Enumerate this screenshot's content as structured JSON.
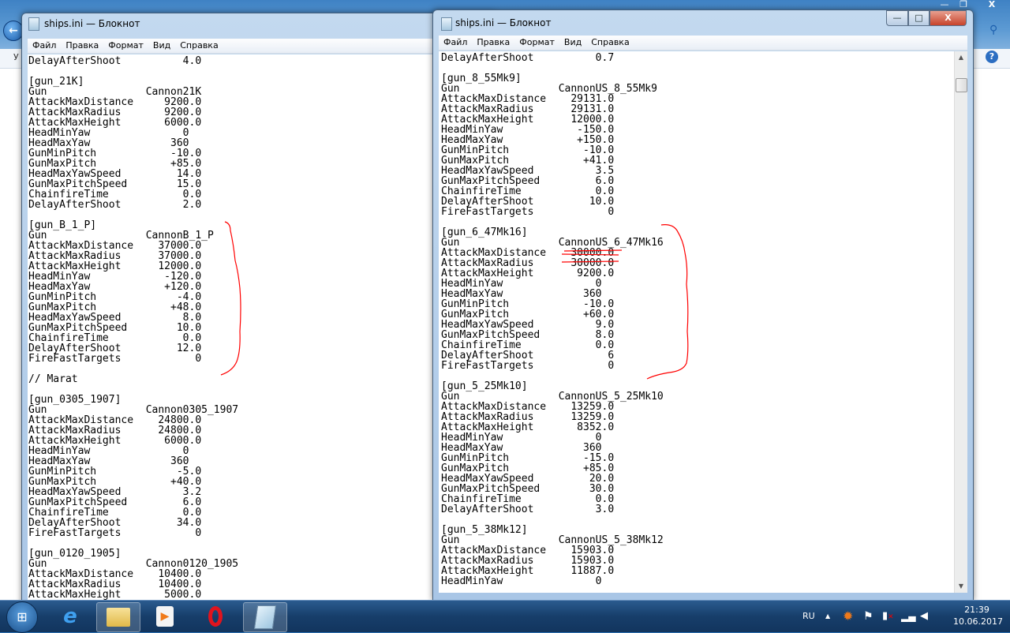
{
  "colors": {
    "annotation": "#ff0000",
    "taskbar": "#173e6a",
    "title_bar": "#b9d1ea"
  },
  "background_window": {
    "nav_letter": "У",
    "icons": [
      "back-arrow-icon",
      "search-icon",
      "help-icon"
    ],
    "help_glyph": "?"
  },
  "left_window": {
    "title": "ships.ini — Блокнот",
    "menu": [
      "Файл",
      "Правка",
      "Формат",
      "Вид",
      "Справка"
    ],
    "lines": [
      "DelayAfterShoot          4.0",
      "",
      "[gun_21K]",
      "Gun                Cannon21K",
      "AttackMaxDistance     9200.0",
      "AttackMaxRadius       9200.0",
      "AttackMaxHeight       6000.0",
      "HeadMinYaw               0",
      "HeadMaxYaw             360",
      "GunMinPitch            -10.0",
      "GunMaxPitch            +85.0",
      "HeadMaxYawSpeed         14.0",
      "GunMaxPitchSpeed        15.0",
      "ChainfireTime            0.0",
      "DelayAfterShoot          2.0",
      "",
      "[gun_B_1_P]",
      "Gun                CannonB_1_P",
      "AttackMaxDistance    37000.0",
      "AttackMaxRadius      37000.0",
      "AttackMaxHeight      12000.0",
      "HeadMinYaw            -120.0",
      "HeadMaxYaw            +120.0",
      "GunMinPitch             -4.0",
      "GunMaxPitch            +48.0",
      "HeadMaxYawSpeed          8.0",
      "GunMaxPitchSpeed        10.0",
      "ChainfireTime            0.0",
      "DelayAfterShoot         12.0",
      "FireFastTargets            0",
      "",
      "// Marat",
      "",
      "[gun_0305_1907]",
      "Gun                Cannon0305_1907",
      "AttackMaxDistance    24800.0",
      "AttackMaxRadius      24800.0",
      "AttackMaxHeight       6000.0",
      "HeadMinYaw               0",
      "HeadMaxYaw             360",
      "GunMinPitch             -5.0",
      "GunMaxPitch            +40.0",
      "HeadMaxYawSpeed          3.2",
      "GunMaxPitchSpeed         6.0",
      "ChainfireTime            0.0",
      "DelayAfterShoot         34.0",
      "FireFastTargets            0",
      "",
      "[gun_0120_1905]",
      "Gun                Cannon0120_1905",
      "AttackMaxDistance    10400.0",
      "AttackMaxRadius      10400.0",
      "AttackMaxHeight       5000.0"
    ]
  },
  "right_window": {
    "title": "ships.ini — Блокнот",
    "menu": [
      "Файл",
      "Правка",
      "Формат",
      "Вид",
      "Справка"
    ],
    "buttons": {
      "minimize": "—",
      "maximize": "□",
      "close": "X"
    },
    "lines": [
      "DelayAfterShoot          0.7",
      "",
      "[gun_8_55Mk9]",
      "Gun                CannonUS_8_55Mk9",
      "AttackMaxDistance    29131.0",
      "AttackMaxRadius      29131.0",
      "AttackMaxHeight      12000.0",
      "HeadMinYaw            -150.0",
      "HeadMaxYaw            +150.0",
      "GunMinPitch            -10.0",
      "GunMaxPitch            +41.0",
      "HeadMaxYawSpeed          3.5",
      "GunMaxPitchSpeed         6.0",
      "ChainfireTime            0.0",
      "DelayAfterShoot         10.0",
      "FireFastTargets            0",
      "",
      "[gun_6_47Mk16]",
      "Gun                CannonUS_6_47Mk16",
      "AttackMaxDistance    30000.0",
      "AttackMaxRadius      30000.0",
      "AttackMaxHeight       9200.0",
      "HeadMinYaw               0",
      "HeadMaxYaw             360",
      "GunMinPitch            -10.0",
      "GunMaxPitch            +60.0",
      "HeadMaxYawSpeed          9.0",
      "GunMaxPitchSpeed         8.0",
      "ChainfireTime            0.0",
      "DelayAfterShoot            6",
      "FireFastTargets            0",
      "",
      "[gun_5_25Mk10]",
      "Gun                CannonUS_5_25Mk10",
      "AttackMaxDistance    13259.0",
      "AttackMaxRadius      13259.0",
      "AttackMaxHeight       8352.0",
      "HeadMinYaw               0",
      "HeadMaxYaw             360",
      "GunMinPitch            -15.0",
      "GunMaxPitch            +85.0",
      "HeadMaxYawSpeed         20.0",
      "GunMaxPitchSpeed        30.0",
      "ChainfireTime            0.0",
      "DelayAfterShoot          3.0",
      "",
      "[gun_5_38Mk12]",
      "Gun                CannonUS_5_38Mk12",
      "AttackMaxDistance    15903.0",
      "AttackMaxRadius      15903.0",
      "AttackMaxHeight      11887.0",
      "HeadMinYaw               0"
    ]
  },
  "taskbar": {
    "apps": [
      "start-button",
      "internet-explorer",
      "windows-explorer",
      "media-player",
      "opera",
      "notepad"
    ],
    "tray": {
      "language": "RU",
      "show_hidden": "▲",
      "time": "21:39",
      "date": "10.06.2017"
    }
  }
}
